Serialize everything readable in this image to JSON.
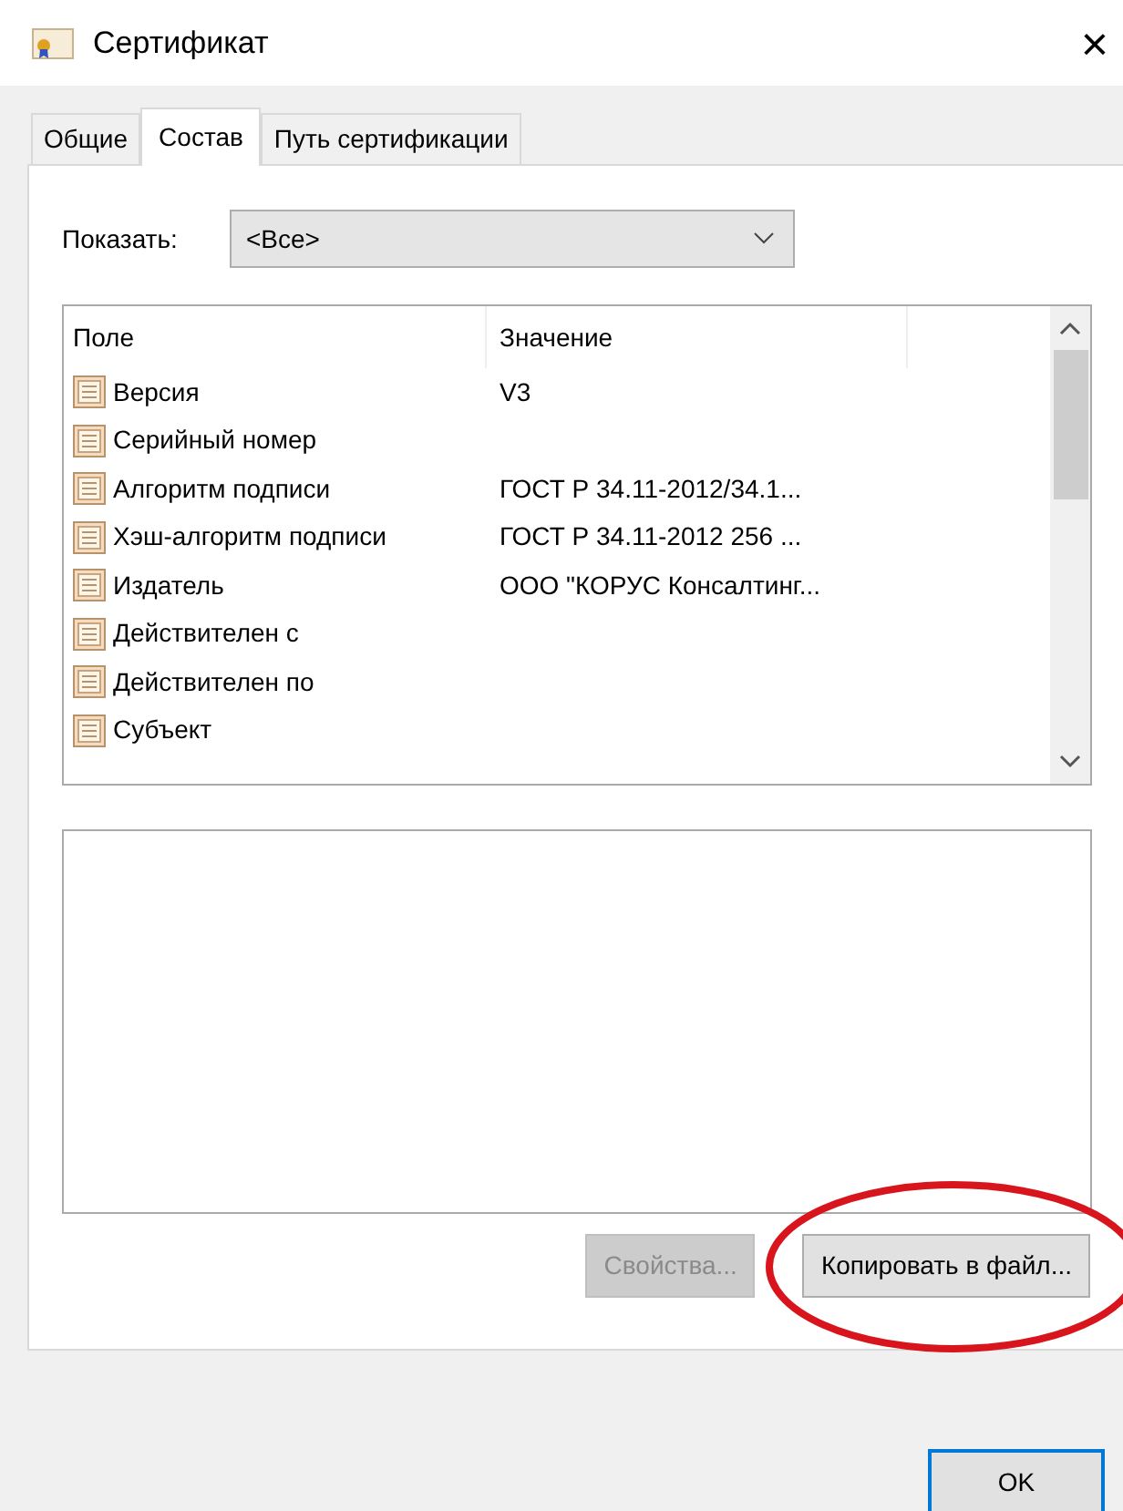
{
  "window": {
    "title": "Сертификат",
    "close": "×"
  },
  "tabs": [
    {
      "label": "Общие",
      "selected": false
    },
    {
      "label": "Состав",
      "selected": true
    },
    {
      "label": "Путь сертификации",
      "selected": false
    }
  ],
  "show": {
    "label": "Показать:",
    "value": "<Все>"
  },
  "table": {
    "columns": [
      "Поле",
      "Значение"
    ],
    "rows": [
      {
        "field": "Версия",
        "value": "V3"
      },
      {
        "field": "Серийный номер",
        "value": ""
      },
      {
        "field": "Алгоритм подписи",
        "value": "ГОСТ Р 34.11-2012/34.1..."
      },
      {
        "field": "Хэш-алгоритм подписи",
        "value": "ГОСТ Р 34.11-2012 256 ..."
      },
      {
        "field": "Издатель",
        "value": "ООО \"КОРУС Консалтинг..."
      },
      {
        "field": "Действителен с",
        "value": ""
      },
      {
        "field": "Действителен по",
        "value": ""
      },
      {
        "field": "Субъект",
        "value": ""
      }
    ]
  },
  "buttons": [
    {
      "label": "Свойства...",
      "disabled": true,
      "highlighted": false
    },
    {
      "label": "Копировать в файл...",
      "disabled": false,
      "highlighted": true
    }
  ],
  "footer": {
    "ok": {
      "label": "OK",
      "default": true
    }
  }
}
